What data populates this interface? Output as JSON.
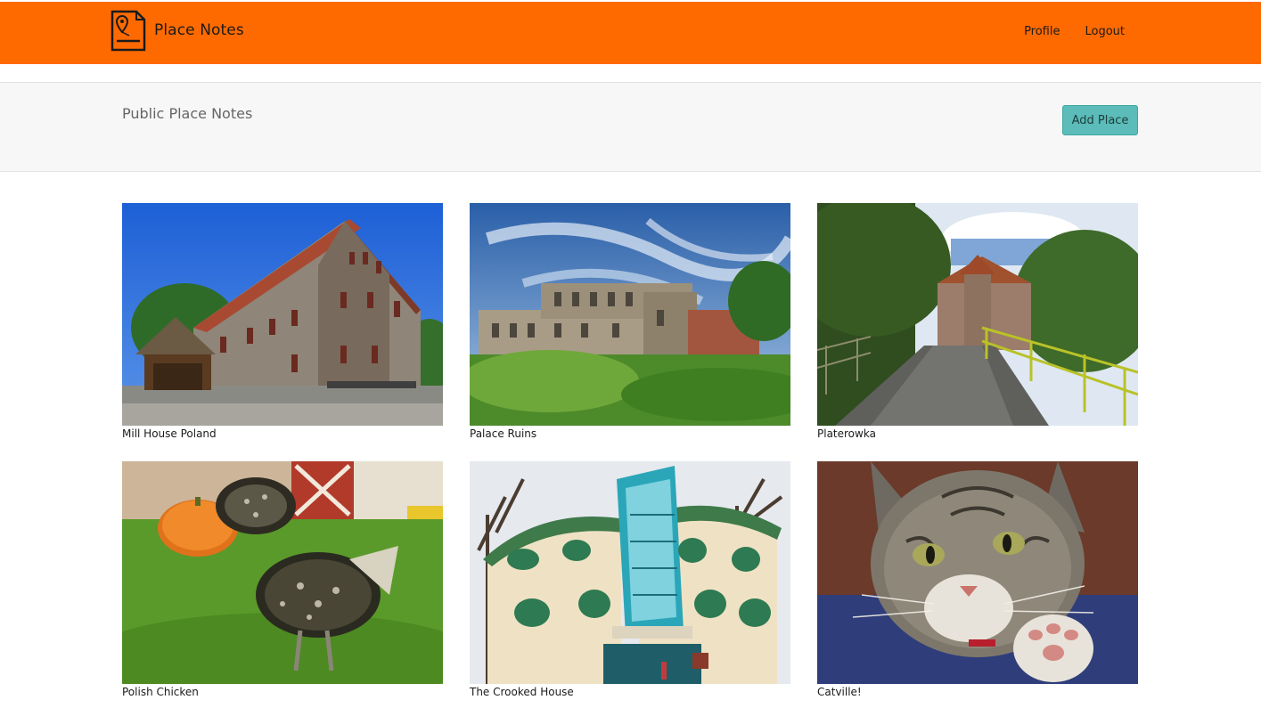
{
  "navbar": {
    "brand": "Place Notes",
    "brand_logo_icon": "map-pin-document-icon",
    "links": [
      {
        "label": "Profile"
      },
      {
        "label": "Logout"
      }
    ],
    "background": "#ff6a00"
  },
  "subheader": {
    "title": "Public Place Notes",
    "add_button": "Add Place",
    "button_color": "#5bbcb9"
  },
  "places": [
    {
      "title": "Mill House Poland",
      "image": "stone-mill-house-photo"
    },
    {
      "title": "Palace Ruins",
      "image": "palace-ruins-photo"
    },
    {
      "title": "Platerowka",
      "image": "castle-road-photo"
    },
    {
      "title": "Polish Chicken",
      "image": "chicken-pumpkin-photo"
    },
    {
      "title": "The Crooked House",
      "image": "crooked-house-photo"
    },
    {
      "title": "Catville!",
      "image": "cat-photo"
    }
  ]
}
